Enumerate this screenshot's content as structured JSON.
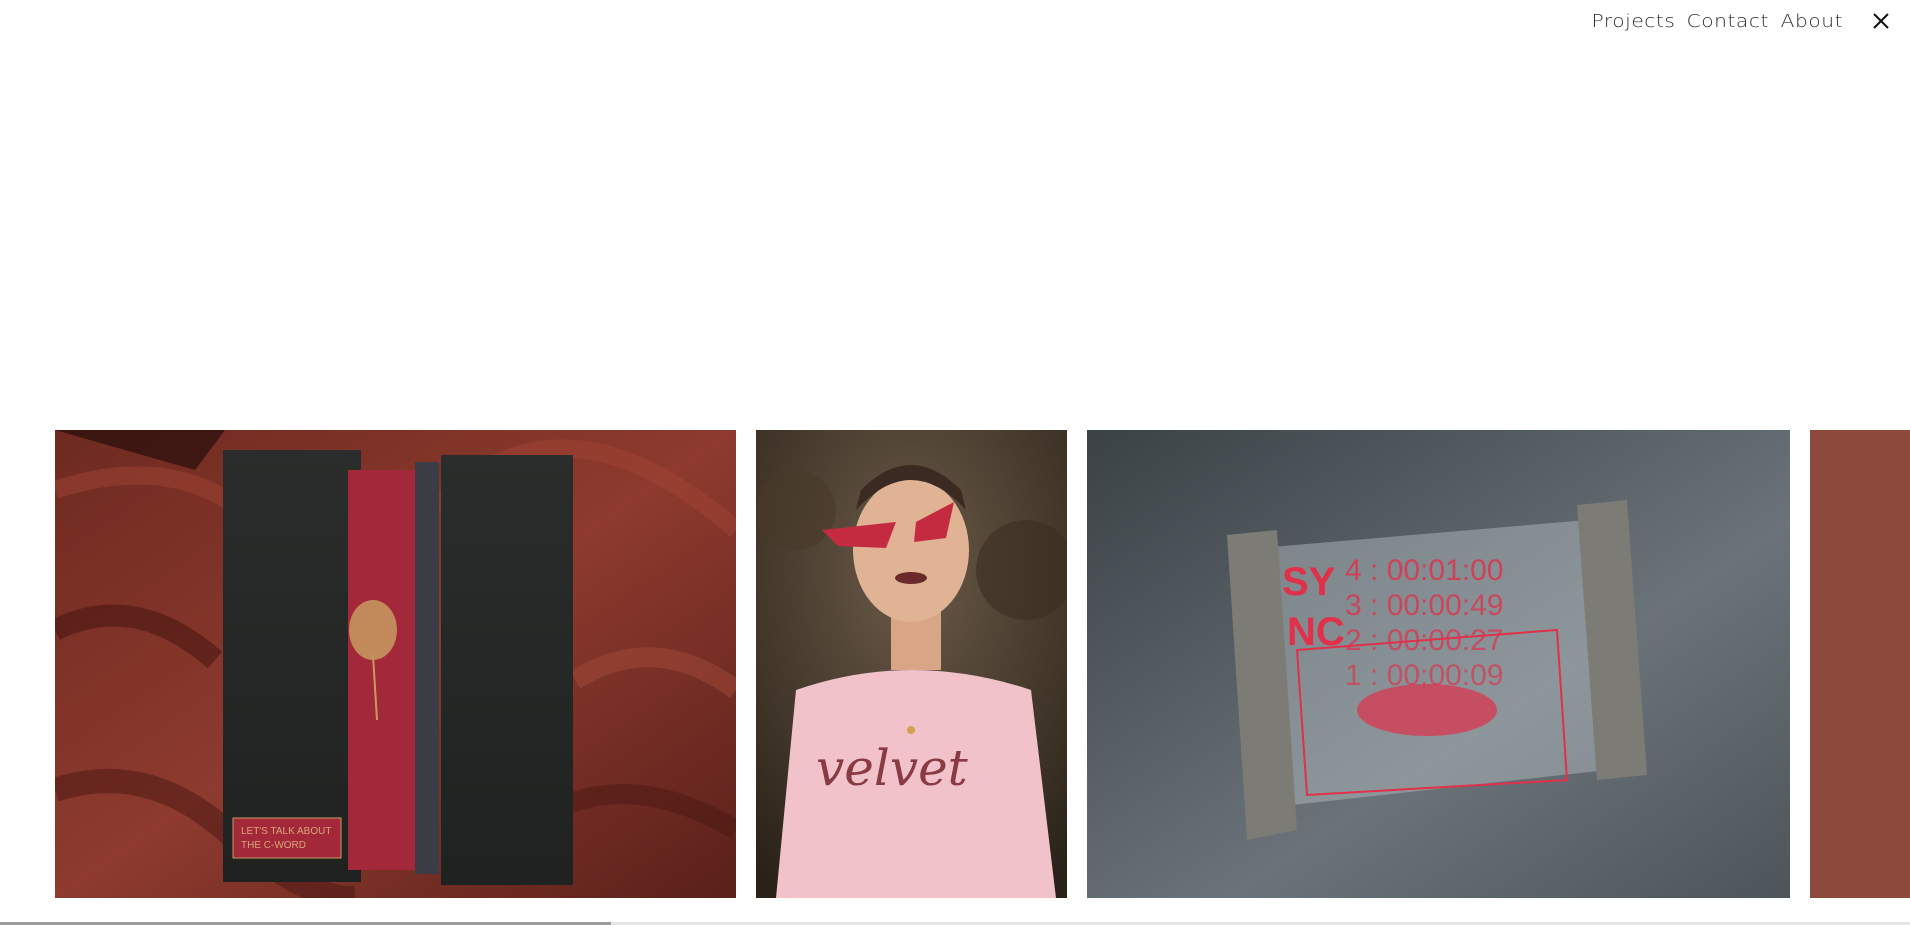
{
  "nav": {
    "links": [
      "Projects",
      "Contact",
      "About"
    ],
    "close_icon": "close-icon"
  },
  "gallery": {
    "items": [
      {
        "name": "book-box-project",
        "text_lines": [
          "LET'S TALK ABOUT",
          "THE C-WORD"
        ]
      },
      {
        "name": "velvet-tshirt-project",
        "shirt_text": "velvet"
      },
      {
        "name": "sync-display-project",
        "lines": [
          "SY",
          "NC",
          "4 : 00:01:00",
          "3 : 00:00:49",
          "2 : 00:00:27",
          "1 : 00:00:09"
        ]
      },
      {
        "name": "partial-next-project"
      }
    ]
  },
  "scroll_progress": 0.32,
  "colors": {
    "text": "#2a2a2a",
    "accent_red": "#e0304a",
    "rust": "#8c4a3c"
  }
}
